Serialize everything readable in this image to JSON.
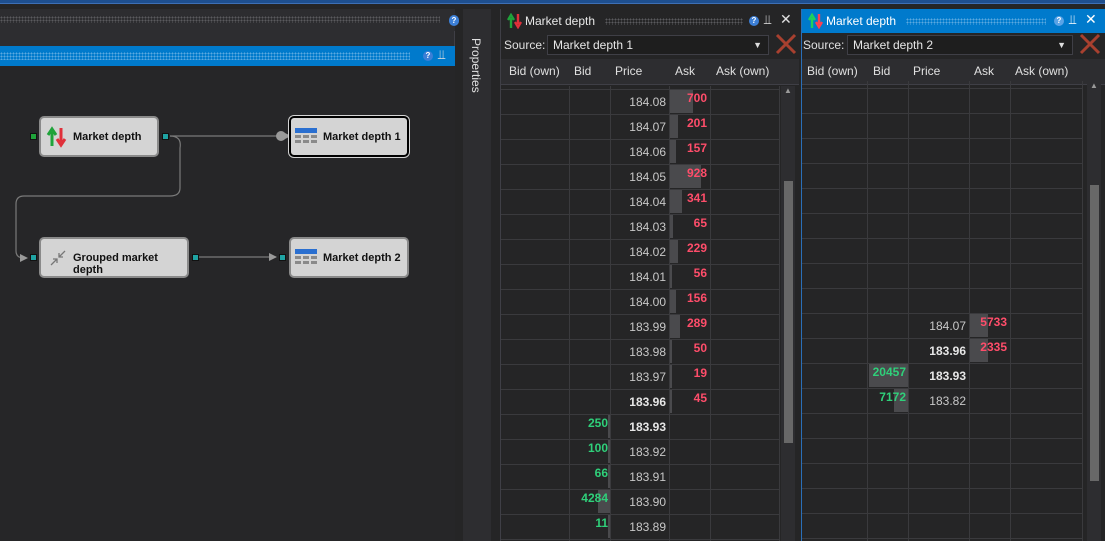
{
  "designer": {
    "nodes": [
      {
        "label": "Market depth"
      },
      {
        "label": "Market depth 1"
      },
      {
        "label": "Grouped market depth"
      },
      {
        "label": "Market depth 2"
      }
    ],
    "properties_label": "Properties"
  },
  "panel1": {
    "title": "Market depth",
    "source_label": "Source:",
    "source_value": "Market depth 1",
    "columns": [
      "Bid (own)",
      "Bid",
      "Price",
      "Ask",
      "Ask (own)"
    ],
    "rows": [
      {
        "price": "184.08",
        "ask": "700",
        "bid": "",
        "ask_fill": 0.55
      },
      {
        "price": "184.07",
        "ask": "201",
        "bid": "",
        "ask_fill": 0.2
      },
      {
        "price": "184.06",
        "ask": "157",
        "bid": "",
        "ask_fill": 0.15
      },
      {
        "price": "184.05",
        "ask": "928",
        "bid": "",
        "ask_fill": 0.75
      },
      {
        "price": "184.04",
        "ask": "341",
        "bid": "",
        "ask_fill": 0.3
      },
      {
        "price": "184.03",
        "ask": "65",
        "bid": "",
        "ask_fill": 0.07
      },
      {
        "price": "184.02",
        "ask": "229",
        "bid": "",
        "ask_fill": 0.2
      },
      {
        "price": "184.01",
        "ask": "56",
        "bid": "",
        "ask_fill": 0.06
      },
      {
        "price": "184.00",
        "ask": "156",
        "bid": "",
        "ask_fill": 0.15
      },
      {
        "price": "183.99",
        "ask": "289",
        "bid": "",
        "ask_fill": 0.25
      },
      {
        "price": "183.98",
        "ask": "50",
        "bid": "",
        "ask_fill": 0.05
      },
      {
        "price": "183.97",
        "ask": "19",
        "bid": "",
        "ask_fill": 0.02
      },
      {
        "price": "183.96",
        "ask": "45",
        "bid": "",
        "ask_fill": 0.04,
        "bold": true
      },
      {
        "price": "183.93",
        "ask": "",
        "bid": "250",
        "bid_fill": 0.05,
        "bold": true
      },
      {
        "price": "183.92",
        "ask": "",
        "bid": "100",
        "bid_fill": 0.03
      },
      {
        "price": "183.91",
        "ask": "",
        "bid": "66",
        "bid_fill": 0.02
      },
      {
        "price": "183.90",
        "ask": "",
        "bid": "4284",
        "bid_fill": 0.3
      },
      {
        "price": "183.89",
        "ask": "",
        "bid": "11",
        "bid_fill": 0.01
      }
    ]
  },
  "panel2": {
    "title": "Market depth",
    "source_label": "Source:",
    "source_value": "Market depth 2",
    "columns": [
      "Bid (own)",
      "Bid",
      "Price",
      "Ask",
      "Ask (own)"
    ],
    "rows": [
      {
        "price": "184.07",
        "ask": "5733",
        "bid": "",
        "ask_fill": 0.45
      },
      {
        "price": "183.96",
        "ask": "2335",
        "bid": "",
        "ask_fill": 0.45,
        "bold": true
      },
      {
        "price": "183.93",
        "ask": "",
        "bid": "20457",
        "bid_fill": 0.95,
        "bold": true
      },
      {
        "price": "183.82",
        "ask": "",
        "bid": "7172",
        "bid_fill": 0.35
      }
    ]
  },
  "colors": {
    "accent": "#007acc",
    "ask": "#ff4d6a",
    "bid": "#2fd07a"
  }
}
